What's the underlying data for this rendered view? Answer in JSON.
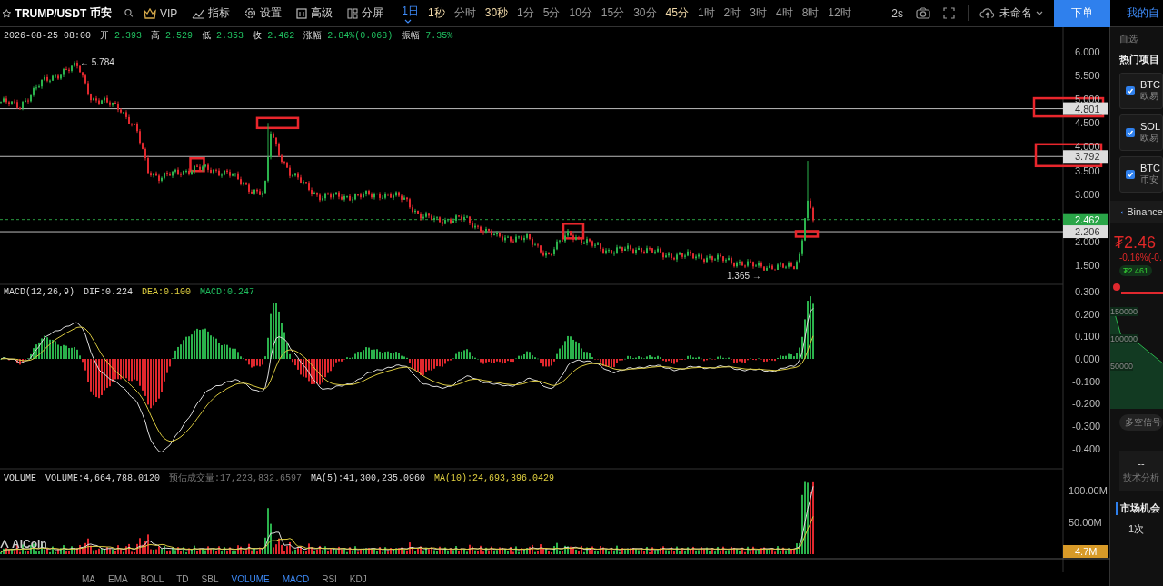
{
  "toolbar": {
    "symbol": "TRUMP/USDT",
    "exchange": "币安",
    "menu": [
      {
        "label": "VIP",
        "kind": "crown"
      },
      {
        "label": "指标",
        "kind": "chart"
      },
      {
        "label": "设置",
        "kind": "gear"
      },
      {
        "label": "高级",
        "kind": "panel"
      },
      {
        "label": "分屏",
        "kind": "split"
      }
    ],
    "intervals": [
      {
        "label": "1日",
        "selected": true,
        "highlighted": false
      },
      {
        "label": "1秒",
        "selected": false,
        "highlighted": true
      },
      {
        "label": "分时",
        "selected": false,
        "highlighted": false
      },
      {
        "label": "30秒",
        "selected": false,
        "highlighted": true
      },
      {
        "label": "1分",
        "selected": false,
        "highlighted": false
      },
      {
        "label": "5分",
        "selected": false,
        "highlighted": false
      },
      {
        "label": "10分",
        "selected": false,
        "highlighted": false
      },
      {
        "label": "15分",
        "selected": false,
        "highlighted": false
      },
      {
        "label": "30分",
        "selected": false,
        "highlighted": false
      },
      {
        "label": "45分",
        "selected": false,
        "highlighted": true
      },
      {
        "label": "1时",
        "selected": false,
        "highlighted": false
      },
      {
        "label": "2时",
        "selected": false,
        "highlighted": false
      },
      {
        "label": "3时",
        "selected": false,
        "highlighted": false
      },
      {
        "label": "4时",
        "selected": false,
        "highlighted": false
      },
      {
        "label": "8时",
        "selected": false,
        "highlighted": false
      },
      {
        "label": "12时",
        "selected": false,
        "highlighted": false
      }
    ],
    "refresh": "2s",
    "layout_name": "未命名",
    "order_button": "下单",
    "panel_tab": "我的自"
  },
  "price_pane": {
    "legend": [
      {
        "label": "2026-08-25 08:00"
      },
      {
        "label": "开",
        "value": "2.393"
      },
      {
        "label": "高",
        "value": "2.529"
      },
      {
        "label": "低",
        "value": "2.353"
      },
      {
        "label": "收",
        "value": "2.462"
      },
      {
        "label": "涨幅",
        "value": "2.84%(0.068)"
      },
      {
        "label": "振幅",
        "value": "7.35%"
      }
    ],
    "axis": [
      "6.000",
      "5.500",
      "5.000",
      "4.500",
      "4.000",
      "3.500",
      "3.000",
      "2.000",
      "1.500"
    ],
    "high_marker": "← 5.784",
    "low_marker": "1.365 →",
    "tags": [
      {
        "label": "4.801",
        "kind": "line"
      },
      {
        "label": "3.792",
        "kind": "line"
      },
      {
        "label": "2.462",
        "kind": "current"
      },
      {
        "label": "2.206",
        "kind": "line"
      }
    ],
    "chart_logo": "AiCoin"
  },
  "macd_pane": {
    "legend": [
      {
        "label": "MACD(12,26,9)",
        "kind": "name"
      },
      {
        "label": "DIF:0.224",
        "kind": "dif"
      },
      {
        "label": "DEA:0.100",
        "kind": "dea"
      },
      {
        "label": "MACD:0.247",
        "kind": "macd"
      }
    ],
    "axis": [
      "0.300",
      "0.200",
      "0.100",
      "0.000",
      "-0.100",
      "-0.200",
      "-0.300",
      "-0.400"
    ]
  },
  "volume_pane": {
    "legend": [
      {
        "label": "VOLUME",
        "kind": "name"
      },
      {
        "label": "VOLUME:4,664,788.0120",
        "kind": "name"
      },
      {
        "label": "预估成交量:17,223,832.6597",
        "kind": "estimate"
      },
      {
        "label": "MA(5):41,300,235.0960",
        "kind": "name"
      },
      {
        "label": "MA(10):24,693,396.0429",
        "kind": "dea"
      }
    ],
    "axis": [
      "100.00M",
      "50.00M"
    ],
    "tag": "4.7M"
  },
  "indicator_tabs": [
    {
      "label": "MA",
      "selected": false
    },
    {
      "label": "EMA",
      "selected": false
    },
    {
      "label": "BOLL",
      "selected": false
    },
    {
      "label": "TD",
      "selected": false
    },
    {
      "label": "SBL",
      "selected": false
    },
    {
      "label": "VOLUME",
      "selected": true
    },
    {
      "label": "MACD",
      "selected": true
    },
    {
      "label": "RSI",
      "selected": false
    },
    {
      "label": "KDJ",
      "selected": false
    }
  ],
  "side_panel": {
    "section": "自选",
    "hot_title": "热门项目",
    "items": [
      {
        "name": "BTC",
        "exchange": "欧易",
        "checked": true
      },
      {
        "name": "SOL",
        "exchange": "欧易",
        "checked": true
      },
      {
        "name": "BTC",
        "exchange": "币安",
        "checked": true
      }
    ],
    "ticker": "Binance",
    "price": "₮2.46",
    "change": "-0.16%(-0.",
    "badge": "₮2.461",
    "depth_axis": [
      "150000",
      "100000",
      "50000"
    ],
    "signal_button": "多空信号",
    "analysis_value": "--",
    "analysis_label": "技术分析",
    "opportunity_title": "市场机会",
    "opportunity_count": "1次"
  }
}
